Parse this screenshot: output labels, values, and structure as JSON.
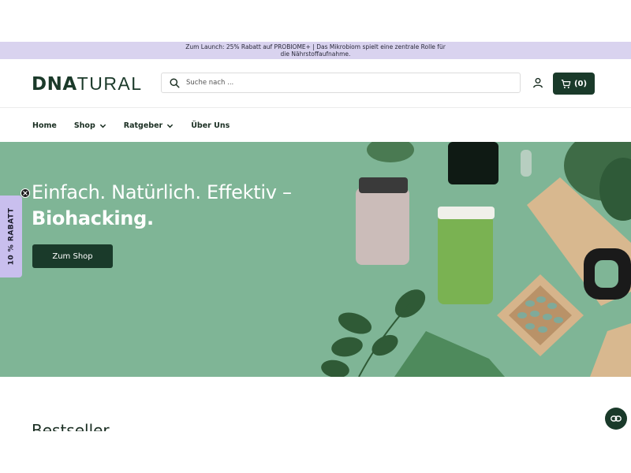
{
  "announcement": {
    "text": "Zum Launch: 25% Rabatt auf PROBIOME+ | Das Mikrobiom spielt eine zentrale Rolle für die Nährstoffaufnahme."
  },
  "header": {
    "logo_bold": "DNA",
    "logo_light": "TURAL",
    "search": {
      "placeholder": "Suche nach ..."
    },
    "user_icon": "user-icon",
    "cart_label": "(0)"
  },
  "nav": {
    "items": [
      {
        "label": "Home",
        "dropdown": false
      },
      {
        "label": "Shop",
        "dropdown": true
      },
      {
        "label": "Ratgeber",
        "dropdown": true
      },
      {
        "label": "Über Uns",
        "dropdown": false
      }
    ]
  },
  "hero": {
    "title_line1": "Einfach. Natürlich. Effektiv –",
    "title_line2": "Biohacking.",
    "cta_label": "Zum Shop",
    "background_color": "#7fb596"
  },
  "discount_tab": {
    "label": "10 % RABATT"
  },
  "section": {
    "title": "Bestseller"
  },
  "colors": {
    "brand_dark": "#1a3a2a",
    "announcement_bg": "#d9d3ef",
    "discount_bg": "#c9bfee"
  }
}
